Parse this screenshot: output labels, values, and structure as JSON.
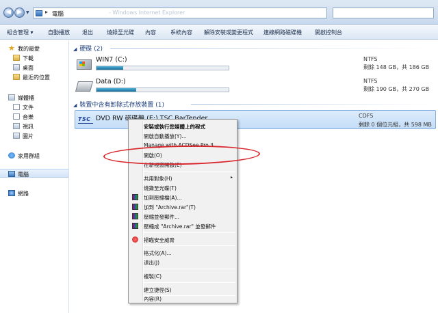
{
  "address_bar": {
    "back_glyph": "◀",
    "forward_glyph": "▶",
    "path_separator": "▸",
    "path_item": "電腦",
    "ghost_text": "- Windows Internet Explorer"
  },
  "toolbar": {
    "items": [
      "組合管理 ▾",
      "自動播放",
      "退出",
      "燒錄至光碟",
      "內容",
      "系統內容",
      "解除安裝或變更程式",
      "連線網路磁碟機",
      "開啟控制台"
    ]
  },
  "nav": {
    "favorites": "我的最愛",
    "downloads": "下載",
    "desktop": "桌面",
    "recent": "最近的位置",
    "libraries": "媒體櫃",
    "documents": "文件",
    "music": "音樂",
    "videos": "視訊",
    "pictures": "圖片",
    "homegroup": "家用群組",
    "computer": "電腦",
    "network": "網路"
  },
  "content": {
    "hard_disks_header": "硬碟 (2)",
    "removable_header": "裝置中含有卸除式存放裝置 (1)",
    "drives": [
      {
        "name": "WIN7 (C:)",
        "fs": "NTFS",
        "space": "剩餘 148 GB，共 186 GB",
        "used_fraction": 0.2
      },
      {
        "name": "Data (D:)",
        "fs": "NTFS",
        "space": "剩餘 190 GB，共 270 GB",
        "used_fraction": 0.3
      }
    ],
    "dvd": {
      "logo": "TSC",
      "name": "DVD RW 磁碟機 (E:) TSC BarTender",
      "fs": "CDFS",
      "space": "剩餘 0 個位元組，共 598 MB"
    }
  },
  "context_menu": {
    "items": [
      "安裝或執行您媒體上的程式",
      "開啟自動播放(Y)...",
      "Manage with ACDSee Pro 3",
      "開啟(O)",
      "在新視窗開啟(E)",
      "共用對象(H)",
      "燒錄至光碟(T)",
      "加到壓縮檔(A)...",
      "加到 \"Archive.rar\"(T)",
      "壓縮並發郵件...",
      "壓縮成 \"Archive.rar\" 並發郵件",
      "掃瞄安全威脅",
      "格式化(A)...",
      "退出(J)",
      "複製(C)",
      "建立捷徑(S)",
      "內容(R)"
    ],
    "submenu_glyph": "▸"
  }
}
